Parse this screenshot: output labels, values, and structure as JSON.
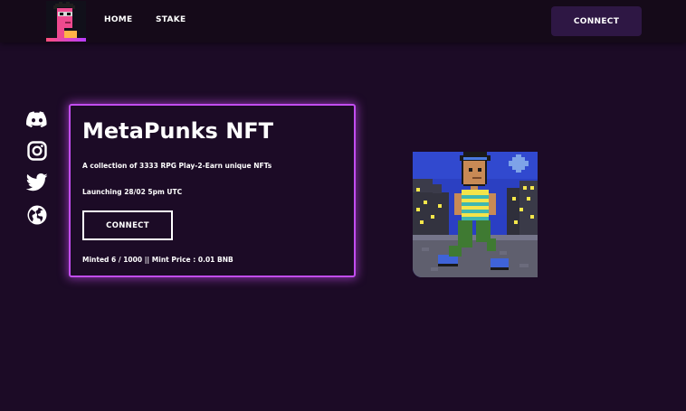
{
  "nav": {
    "logo_icon": "pixel-punk-logo-icon",
    "home_label": "HOME",
    "stake_label": "STAKE",
    "connect_label": "CONNECT"
  },
  "social": [
    "discord-icon",
    "instagram-icon",
    "twitter-icon",
    "globe-icon"
  ],
  "hero": {
    "title": "MetaPunks NFT",
    "description": "A collection of 3333 RPG Play-2-Earn unique NFTs",
    "launch": "Launching 28/02 5pm UTC",
    "connect_label": "CONNECT",
    "minted": "Minted 6 / 1000 || Mint Price : 0.01 BNB"
  },
  "colors": {
    "background": "#1c0b26",
    "navbar": "#150a19",
    "nav_button": "#2e1744",
    "card_border": "#c24df0",
    "text": "#ffffff"
  },
  "nft_image": "pixel-punk-walking-city-night-image"
}
